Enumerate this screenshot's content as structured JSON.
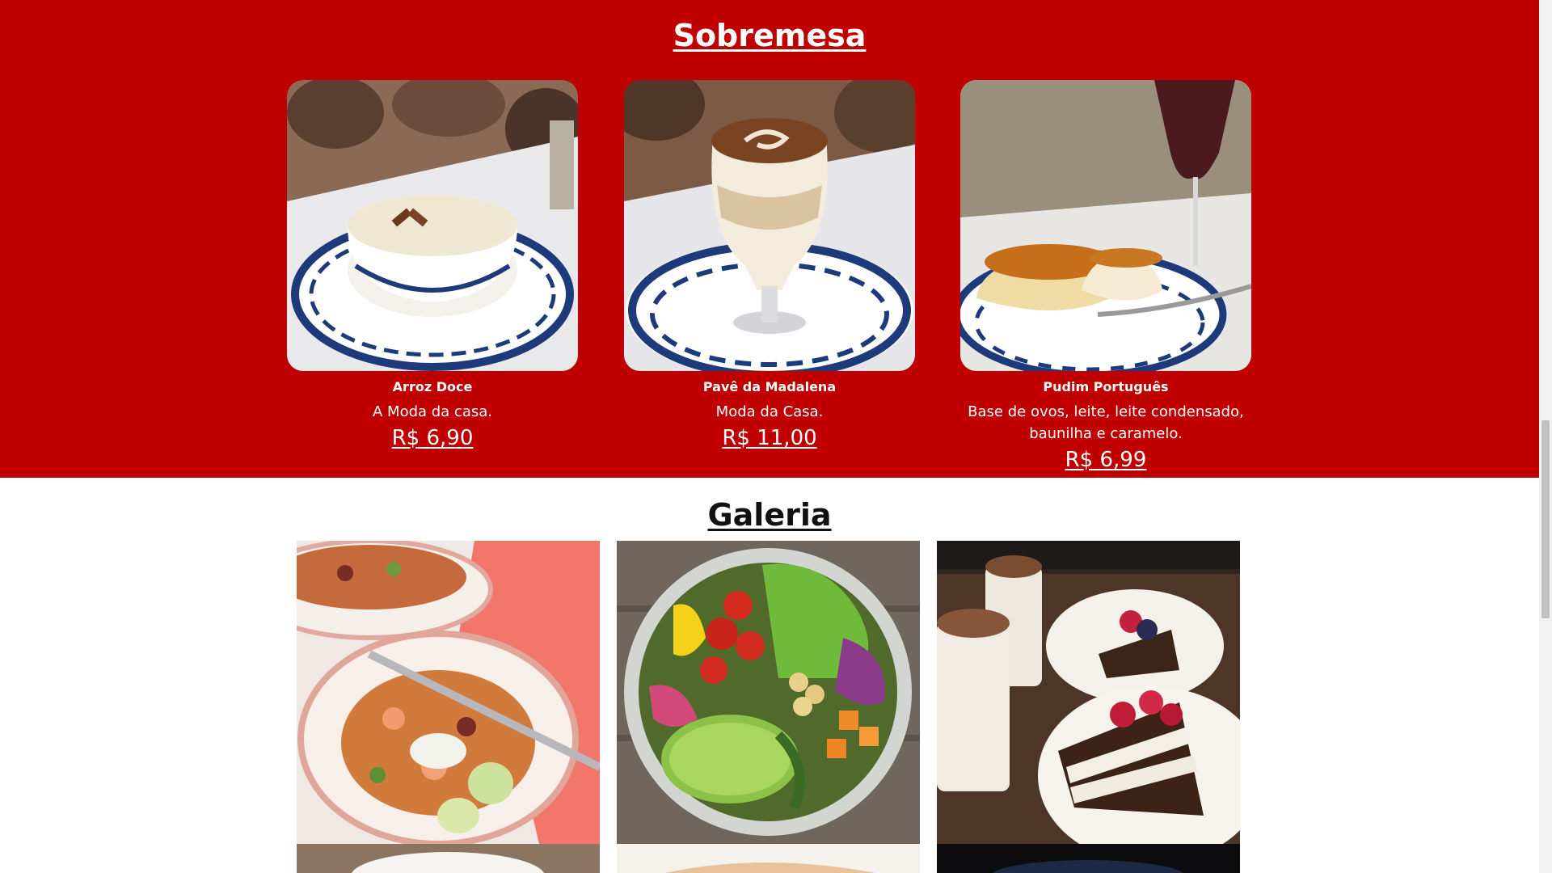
{
  "sobremesa": {
    "title": "Sobremesa",
    "items": [
      {
        "name": "Arroz Doce",
        "description": "A Moda da casa.",
        "price": "R$ 6,90"
      },
      {
        "name": "Pavê da Madalena",
        "description": "Moda da Casa.",
        "price": "R$ 11,00"
      },
      {
        "name": "Pudim Português",
        "description": "Base de ovos, leite, leite condensado, baunilha e caramelo.",
        "price": "R$ 6,99"
      }
    ]
  },
  "galeria": {
    "title": "Galeria"
  },
  "colors": {
    "section_red": "#c00000",
    "text_white": "#ffffff",
    "plate_blue": "#1d3a7a"
  }
}
